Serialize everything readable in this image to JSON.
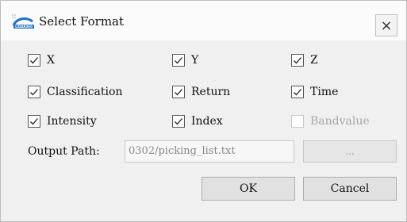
{
  "dialog": {
    "title": "Select Format",
    "app_icon_text": "LiDAR360",
    "close_label": "×"
  },
  "fields": [
    {
      "label": "X",
      "checked": true,
      "enabled": true
    },
    {
      "label": "Y",
      "checked": true,
      "enabled": true
    },
    {
      "label": "Z",
      "checked": true,
      "enabled": true
    },
    {
      "label": "Classification",
      "checked": true,
      "enabled": true
    },
    {
      "label": "Return",
      "checked": true,
      "enabled": true
    },
    {
      "label": "Time",
      "checked": true,
      "enabled": true
    },
    {
      "label": "Intensity",
      "checked": true,
      "enabled": true
    },
    {
      "label": "Index",
      "checked": true,
      "enabled": true
    },
    {
      "label": "Bandvalue",
      "checked": false,
      "enabled": false
    }
  ],
  "output": {
    "label": "Output Path:",
    "value": "0302/picking_list.txt",
    "browse_label": "..."
  },
  "buttons": {
    "ok": "OK",
    "cancel": "Cancel"
  }
}
